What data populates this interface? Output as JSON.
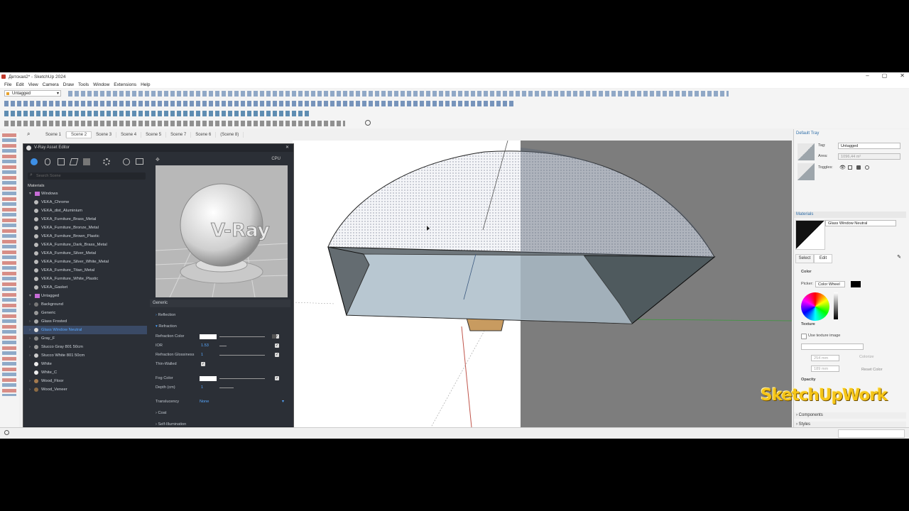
{
  "window": {
    "title": "Детская2* - SketchUp 2024",
    "controls": [
      "–",
      "▢",
      "✕"
    ]
  },
  "menu": [
    "File",
    "Edit",
    "View",
    "Camera",
    "Draw",
    "Tools",
    "Window",
    "Extensions",
    "Help"
  ],
  "toolbar": {
    "tag_selected": "Untagged"
  },
  "scenes": {
    "tabs": [
      "Scene 1",
      "Scene 2",
      "Scene 3",
      "Scene 4",
      "Scene 5",
      "Scene 7",
      "Scene 6",
      "(Scene 8)"
    ],
    "active_index": 1
  },
  "vray": {
    "title": "V-Ray Asset Editor",
    "search_placeholder": "Search Scene",
    "section": "Materials",
    "groups": [
      {
        "name": "Windows",
        "items": [
          "VEKA_Chrome",
          "VEKA_dist_Aluminium",
          "VEKA_Furniture_Brass_Metal",
          "VEKA_Furniture_Bronze_Metal",
          "VEKA_Furniture_Brown_Plastic",
          "VEKA_Furniture_Dark_Brass_Metal",
          "VEKA_Furniture_Silver_Metal",
          "VEKA_Furniture_Silver_White_Metal",
          "VEKA_Furniture_Titan_Metal",
          "VEKA_Furniture_White_Plastic",
          "VEKA_Gasket"
        ]
      },
      {
        "name": "Untagged",
        "items": [
          "Background",
          "Generic",
          "Glass Frosted",
          "Glass Window Neutral",
          "Gray_F",
          "Stucco Gray 801 50cm",
          "Stucco White 801 50cm",
          "White",
          "White_C",
          "Wood_Floor",
          "Wood_Veneer"
        ]
      }
    ],
    "selected_material": "Glass Window Neutral",
    "preview_label": "V-Ray",
    "render_mode": "CPU",
    "props": {
      "header": "Generic",
      "sections": [
        "Reflection",
        "Refraction",
        "Coat",
        "Self-Illumination"
      ],
      "refraction_color": "Refraction Color",
      "ior_label": "IOR",
      "ior_value": "1.53",
      "glossiness_label": "Refraction Glossiness",
      "glossiness_value": "1",
      "thin_walled": "Thin-Walled",
      "fog_color": "Fog Color",
      "depth_label": "Depth (cm)",
      "depth_value": "1",
      "translucency_label": "Translucency",
      "translucency_value": "None"
    }
  },
  "tray": {
    "title": "Default Tray",
    "entity_info": {
      "tag_label": "Tag:",
      "tag_value": "Untagged",
      "area_label": "Area:",
      "area_value": "1096,44 m²",
      "toggles_label": "Toggles:"
    },
    "materials": {
      "header": "Materials",
      "current": "Glass Window Neutral",
      "tabs": [
        "Select",
        "Edit"
      ],
      "color_label": "Color",
      "picker_label": "Picker:",
      "picker_value": "Color Wheel",
      "texture_label": "Texture",
      "use_texture": "Use texture image",
      "width_value": "254 mm",
      "height_value": "189 mm",
      "colorize": "Colorize",
      "reset_color": "Reset Color",
      "opacity_label": "Opacity"
    },
    "components": "Components",
    "styles": "Styles"
  },
  "watermark": "SketchUpWork",
  "colors": {
    "vray_bg": "#2b2f36",
    "selected_row": "#3a4a66",
    "accent_blue": "#58a8ff",
    "tray_header": "#2f6ea8",
    "watermark": "#f5c518"
  }
}
